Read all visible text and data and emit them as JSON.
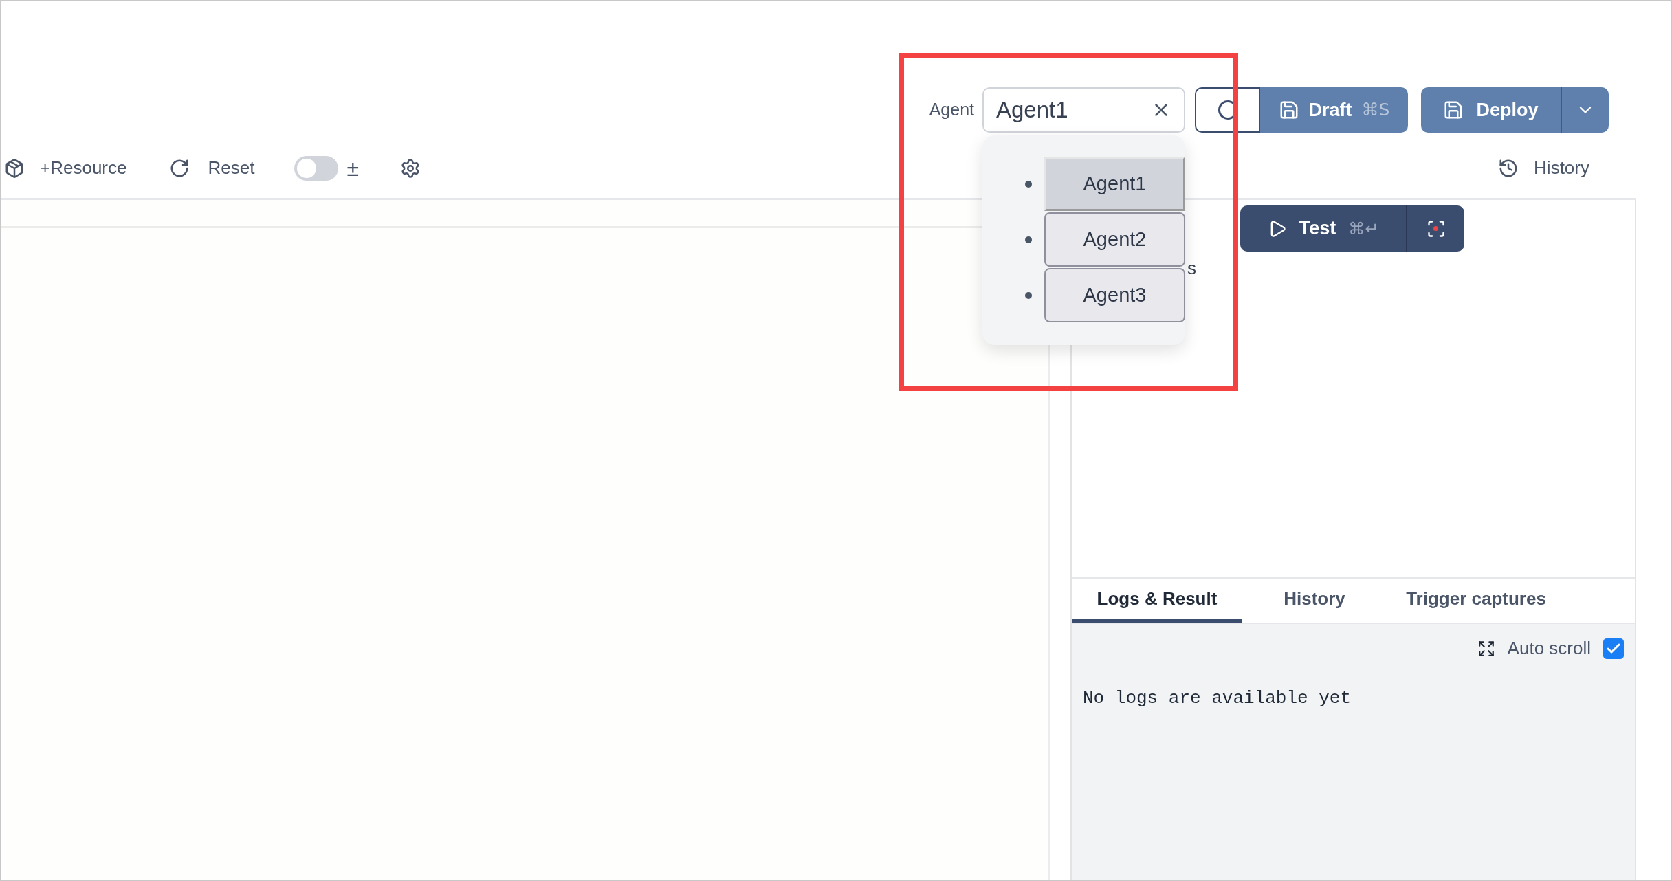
{
  "header": {
    "agent_label": "Agent",
    "agent_select": {
      "value": "Agent1"
    },
    "draft_button": {
      "label": "Draft",
      "shortcut": "⌘S"
    },
    "deploy_button": {
      "label": "Deploy"
    }
  },
  "toolbar": {
    "resource_label": "+Resource",
    "reset_label": "Reset",
    "toggle": {
      "on": false
    },
    "toggle_label": "±",
    "history_label": "History"
  },
  "test_button": {
    "label": "Test",
    "shortcut": "⌘↵"
  },
  "hidden_fragment": "s",
  "agent_dropdown": [
    {
      "label": "Agent1",
      "selected": true
    },
    {
      "label": "Agent2",
      "selected": false
    },
    {
      "label": "Agent3",
      "selected": false
    }
  ],
  "bottom_tabs": [
    {
      "label": "Logs & Result",
      "selected": true
    },
    {
      "label": "History",
      "selected": false
    },
    {
      "label": "Trigger captures",
      "selected": false
    }
  ],
  "auto_scroll": {
    "label": "Auto scroll",
    "checked": true
  },
  "log_message": "No logs are available yet"
}
